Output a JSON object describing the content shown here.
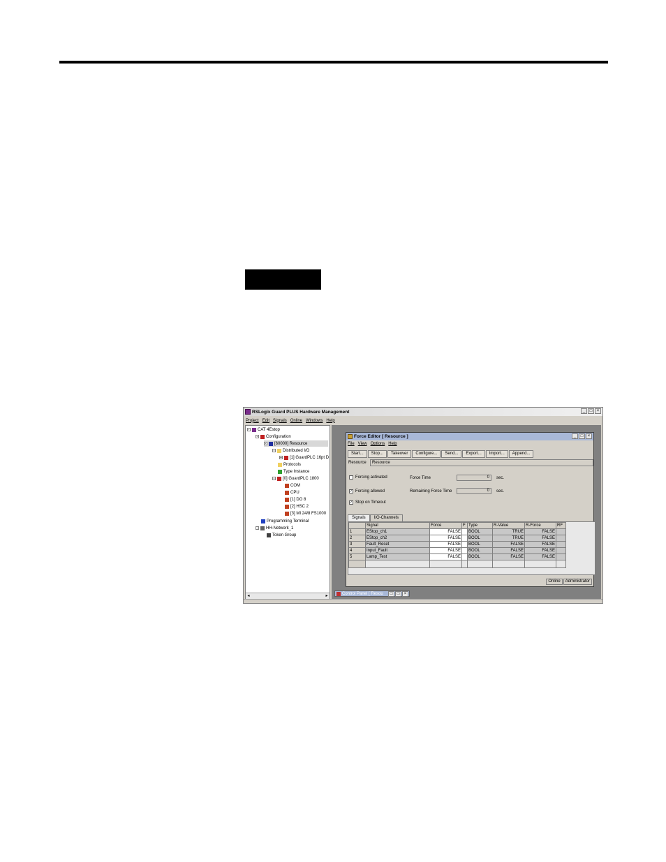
{
  "app": {
    "title": "RSLogix Guard PLUS Hardware Management",
    "menu": [
      "Project",
      "Edit",
      "Signals",
      "Online",
      "Windows",
      "Help"
    ]
  },
  "tree": [
    {
      "label": "CAT 4Estop",
      "icon": "project-icon"
    },
    {
      "label": "Configuration",
      "icon": "configuration-icon"
    },
    {
      "label": "[60000] Resource",
      "icon": "resource-icon"
    },
    {
      "label": "Distributed I/O",
      "icon": "folder-icon"
    },
    {
      "label": "[1] GuardPLC 16pt D",
      "icon": "module-icon"
    },
    {
      "label": "Protocols",
      "icon": "folder-icon"
    },
    {
      "label": "Type Instance",
      "icon": "type-icon"
    },
    {
      "label": "[0] GuardPLC 1800",
      "icon": "plc-icon"
    },
    {
      "label": "COM",
      "icon": "card-icon"
    },
    {
      "label": "CPU",
      "icon": "card-icon"
    },
    {
      "label": "[1] DO 8",
      "icon": "card-icon"
    },
    {
      "label": "[2] HSC 2",
      "icon": "card-icon"
    },
    {
      "label": "[3] MI 24/8 FS1000",
      "icon": "card-icon"
    },
    {
      "label": "Programming Terminal",
      "icon": "terminal-icon"
    },
    {
      "label": "HH-Network_1",
      "icon": "network-icon"
    },
    {
      "label": "Token Group",
      "icon": "token-icon"
    }
  ],
  "force_editor": {
    "title": "Force Editor [ Resource ]",
    "menu": [
      "File",
      "View",
      "Options",
      "Help"
    ],
    "toolbar": [
      "Start...",
      "Stop...",
      "Takeover",
      "Configure...",
      "Send...",
      "Export...",
      "Import...",
      "Append..."
    ],
    "resource_label": "Resource",
    "resource_value": "Resource",
    "forcing_activated": {
      "label": "Forcing activated",
      "checked": false
    },
    "forcing_allowed": {
      "label": "Forcing allowed",
      "checked": true
    },
    "stop_on_timeout": {
      "label": "Stop on Timeout",
      "checked": true
    },
    "force_time_label": "Force Time",
    "force_time_value": "0",
    "remaining_label": "Remaining Force Time",
    "remaining_value": "0",
    "sec_label": "sec.",
    "tabs": [
      "Signals",
      "I/O-Channels"
    ],
    "columns": [
      "",
      "Signal",
      "Force",
      "F",
      "Type",
      "R-Value",
      "R-Force",
      "RF"
    ],
    "rows": [
      {
        "idx": "1",
        "signal": "EStop_ch1",
        "force": "FALSE",
        "f": "",
        "type": "BOOL",
        "rvalue": "TRUE",
        "rforce": "FALSE",
        "rf": ""
      },
      {
        "idx": "2",
        "signal": "EStop_ch2",
        "force": "FALSE",
        "f": "",
        "type": "BOOL",
        "rvalue": "TRUE",
        "rforce": "FALSE",
        "rf": ""
      },
      {
        "idx": "3",
        "signal": "Fault_Reset",
        "force": "FALSE",
        "f": "",
        "type": "BOOL",
        "rvalue": "FALSE",
        "rforce": "FALSE",
        "rf": ""
      },
      {
        "idx": "4",
        "signal": "Input_Fault",
        "force": "FALSE",
        "f": "",
        "type": "BOOL",
        "rvalue": "FALSE",
        "rforce": "FALSE",
        "rf": ""
      },
      {
        "idx": "5",
        "signal": "Lamp_Test",
        "force": "FALSE",
        "f": "",
        "type": "BOOL",
        "rvalue": "FALSE",
        "rforce": "FALSE",
        "rf": ""
      }
    ],
    "status": [
      "Online",
      "Administrator"
    ]
  },
  "control_panel": {
    "title": "Control Panel [ Resou"
  }
}
